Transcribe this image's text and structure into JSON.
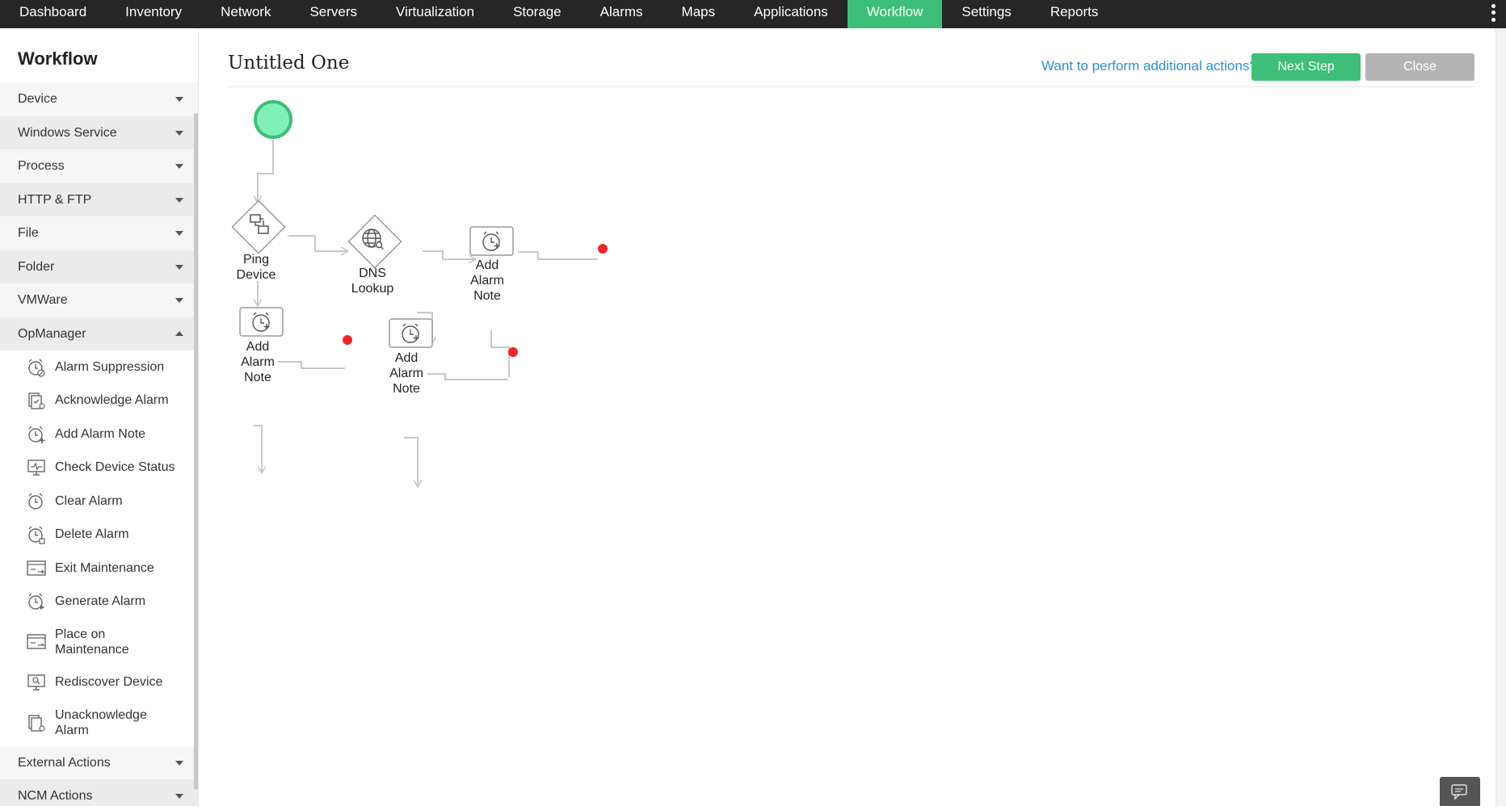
{
  "nav": {
    "items": [
      "Dashboard",
      "Inventory",
      "Network",
      "Servers",
      "Virtualization",
      "Storage",
      "Alarms",
      "Maps",
      "Applications",
      "Workflow",
      "Settings",
      "Reports"
    ],
    "active": "Workflow"
  },
  "sidebar": {
    "title": "Workflow",
    "categories_top": [
      "Device",
      "Windows Service",
      "Process",
      "HTTP & FTP",
      "File",
      "Folder",
      "VMWare"
    ],
    "expanded": "OpManager",
    "opmanager_items": [
      {
        "label": "Alarm Suppression",
        "icon": "alarm-suppression-icon"
      },
      {
        "label": "Acknowledge Alarm",
        "icon": "acknowledge-alarm-icon"
      },
      {
        "label": "Add Alarm Note",
        "icon": "add-alarm-note-icon"
      },
      {
        "label": "Check Device Status",
        "icon": "check-device-status-icon"
      },
      {
        "label": "Clear Alarm",
        "icon": "clear-alarm-icon"
      },
      {
        "label": "Delete Alarm",
        "icon": "delete-alarm-icon"
      },
      {
        "label": "Exit Maintenance",
        "icon": "exit-maintenance-icon"
      },
      {
        "label": "Generate Alarm",
        "icon": "generate-alarm-icon"
      },
      {
        "label": "Place on Maintenance",
        "icon": "place-on-maintenance-icon"
      },
      {
        "label": "Rediscover Device",
        "icon": "rediscover-device-icon"
      },
      {
        "label": "Unacknowledge Alarm",
        "icon": "unacknowledge-alarm-icon"
      }
    ],
    "categories_bottom": [
      "External Actions",
      "NCM Actions"
    ]
  },
  "main": {
    "title": "Untitled One",
    "help_link": "Want to perform additional actions?",
    "next_label": "Next Step",
    "close_label": "Close"
  },
  "workflow": {
    "nodes": {
      "ping": "Ping Device",
      "dns": "DNS Lookup",
      "note_top": "Add Alarm Note",
      "note_left": "Add Alarm Note",
      "note_mid": "Add Alarm Note"
    },
    "colors": {
      "start": "#7ff0b8",
      "start_border": "#3dbf78",
      "end": "#f0262b",
      "connector": "#c8c8c8"
    }
  }
}
